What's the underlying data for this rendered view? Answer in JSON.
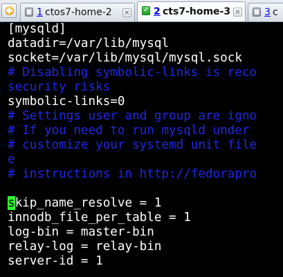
{
  "tabbar": {
    "new_tab_icon": "plus-circle-icon",
    "tabs": [
      {
        "num": "1",
        "name": "ctos7-home-2",
        "status_icon": "session-disconnected-icon",
        "active": false
      },
      {
        "num": "2",
        "name": "cts7-home-3",
        "status_icon": "session-connected-check-icon",
        "active": true
      },
      {
        "num": "3",
        "name": "c",
        "status_icon": "session-disconnected-icon",
        "active": false
      }
    ],
    "close_glyph": "×"
  },
  "terminal": {
    "colors": {
      "background": "#000000",
      "text": "#ffffff",
      "comment": "#1e28e6",
      "cursor": "#2aff2a"
    },
    "lines": [
      {
        "text": "[mysqld]",
        "kind": "plain"
      },
      {
        "text": "datadir=/var/lib/mysql",
        "kind": "plain"
      },
      {
        "text": "socket=/var/lib/mysql/mysql.sock",
        "kind": "plain"
      },
      {
        "text": "# Disabling symbolic-links is reco",
        "kind": "comment"
      },
      {
        "text": "security risks",
        "kind": "comment"
      },
      {
        "text": "symbolic-links=0",
        "kind": "plain"
      },
      {
        "text": "# Settings user and group are igno",
        "kind": "comment"
      },
      {
        "text": "# If you need to run mysqld under",
        "kind": "comment"
      },
      {
        "text": "# customize your systemd unit file",
        "kind": "comment"
      },
      {
        "text": "e",
        "kind": "comment"
      },
      {
        "text": "",
        "kind": "plain"
      },
      {
        "text": "# instructions in http://fedorapro",
        "kind": "comment"
      },
      {
        "text": "",
        "kind": "plain"
      },
      {
        "cursor_char": "s",
        "text": "kip_name_resolve = 1",
        "kind": "cursor-line"
      },
      {
        "text": "innodb_file_per_table = 1",
        "kind": "plain"
      },
      {
        "text": "log-bin = master-bin",
        "kind": "plain"
      },
      {
        "text": "relay-log = relay-bin",
        "kind": "plain"
      },
      {
        "text": "server-id = 1",
        "kind": "plain"
      }
    ]
  }
}
